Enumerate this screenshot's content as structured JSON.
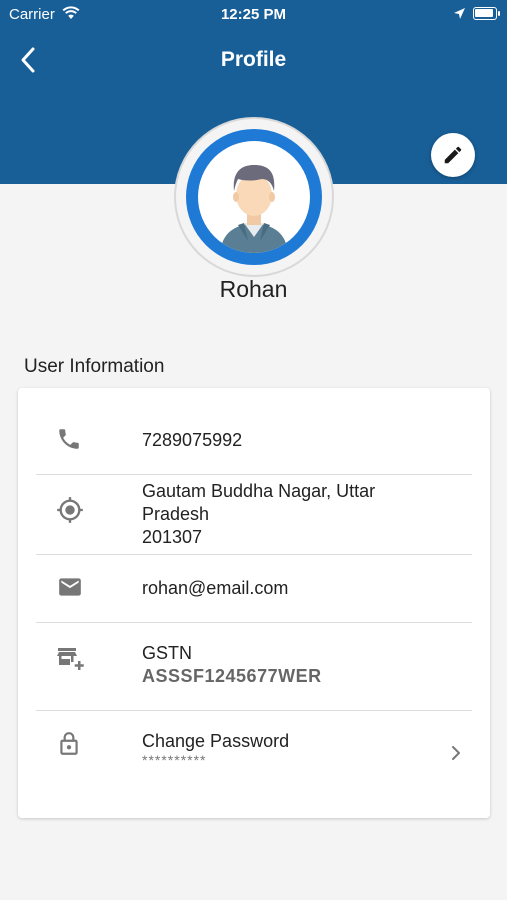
{
  "status_bar": {
    "carrier": "Carrier",
    "time": "12:25 PM"
  },
  "header": {
    "title": "Profile",
    "color": "#185f98"
  },
  "profile": {
    "name": "Rohan"
  },
  "section": {
    "title": "User Information"
  },
  "info": {
    "phone": "7289075992",
    "address_line1": "Gautam Buddha Nagar, Uttar",
    "address_line2": "Pradesh",
    "address_line3": "201307",
    "email": "rohan@email.com",
    "gstn_label": "GSTN",
    "gstn_value": "ASSSF1245677WER",
    "password_label": "Change Password",
    "password_mask": "**********"
  },
  "icons": {
    "back": "back-arrow-icon",
    "edit": "pencil-icon",
    "phone": "phone-icon",
    "location": "location-target-icon",
    "email": "mail-icon",
    "gstn": "store-add-icon",
    "password": "lock-icon",
    "chevron": "chevron-right-icon"
  }
}
